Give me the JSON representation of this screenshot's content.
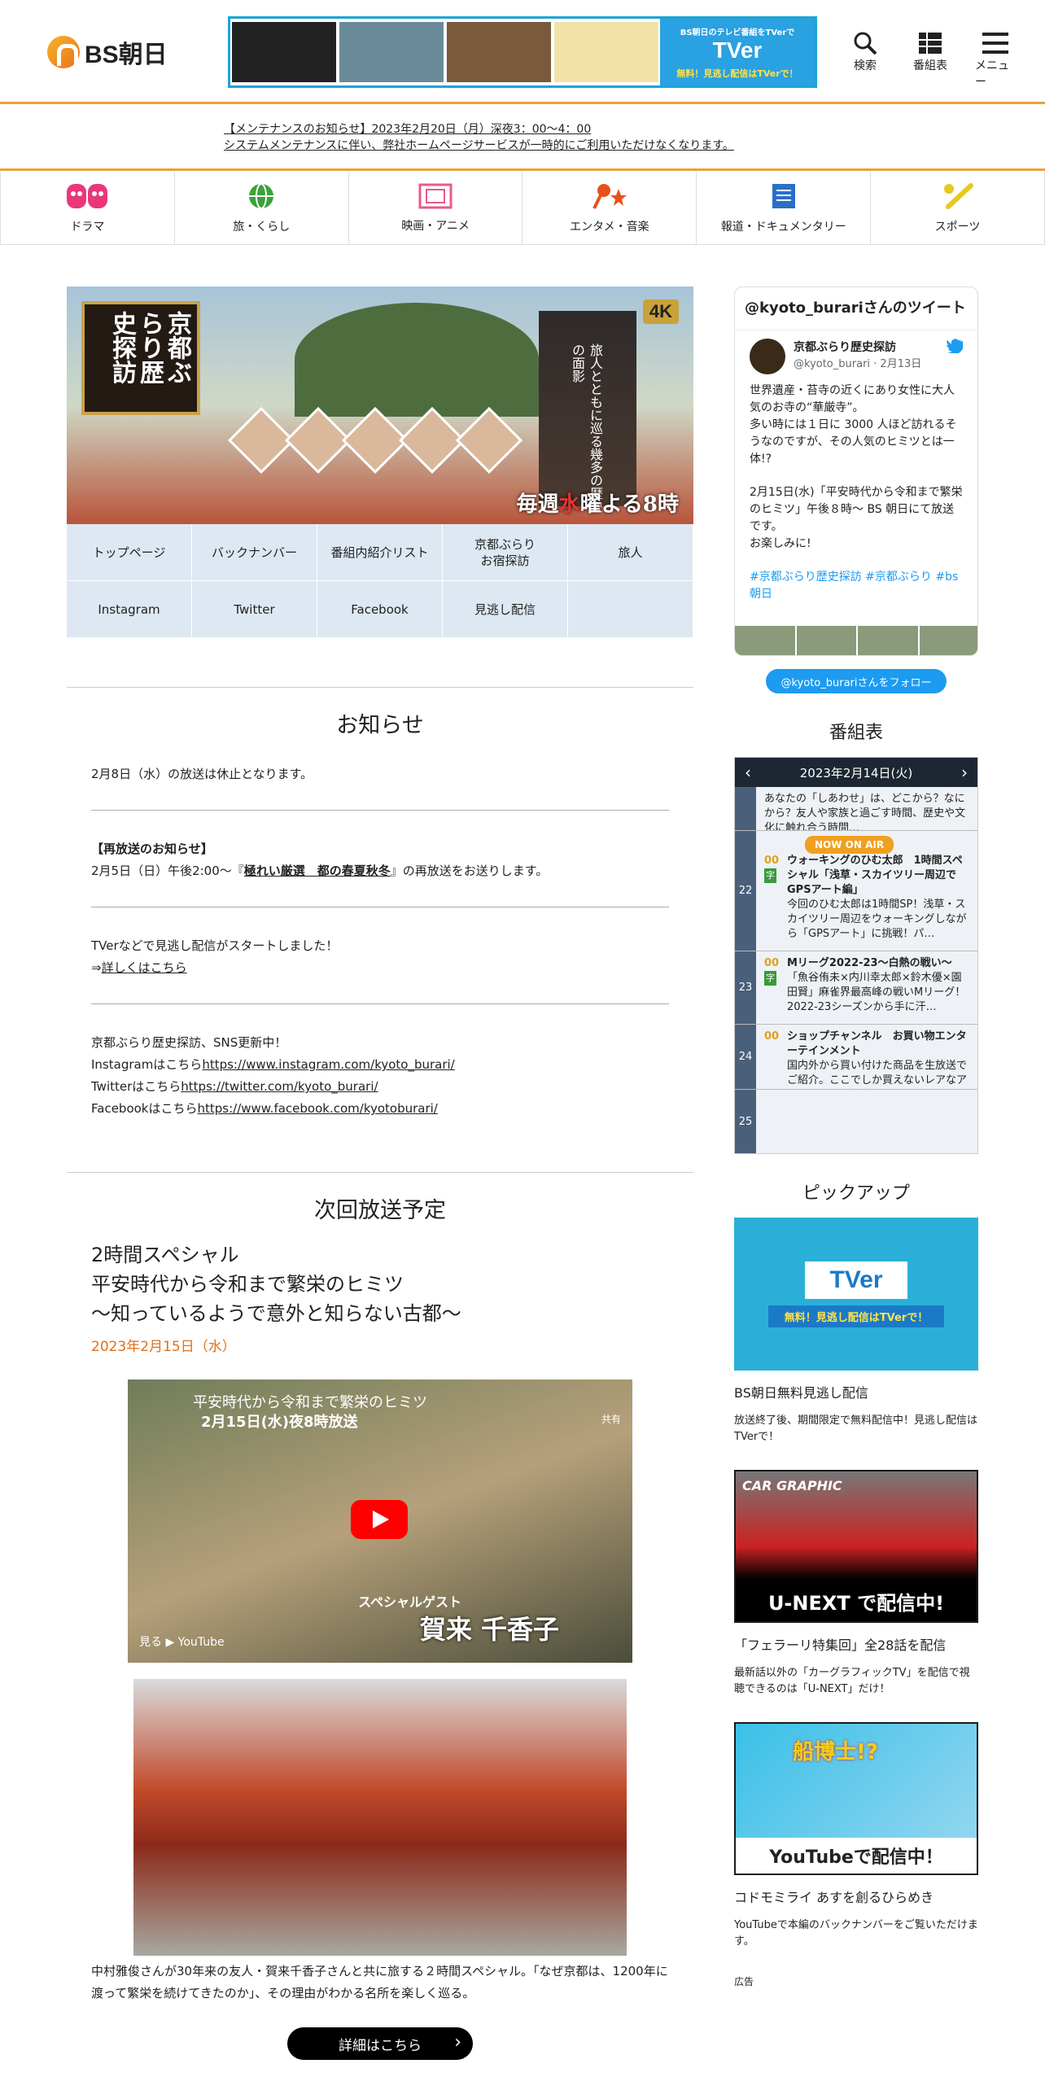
{
  "header": {
    "logo_text": "BS朝日",
    "banner": {
      "tver_logo": "TVer",
      "tver_caption": "無料！見逃し配信はTVerで！",
      "label": "BS朝日のテレビ番組をTVerで"
    },
    "icons": [
      {
        "name": "search-icon",
        "label": "検索"
      },
      {
        "name": "schedule-icon",
        "label": "番組表"
      },
      {
        "name": "menu-icon",
        "label": "メニュー"
      }
    ]
  },
  "notice": {
    "line1": "【メンテナンスのお知らせ】2023年2月20日（月）深夜3：00〜4：00",
    "line2": "システムメンテナンスに伴い、弊社ホームページサービスが一時的にご利用いただけなくなります。"
  },
  "genres": [
    {
      "label": "ドラマ",
      "color": "#e8387a"
    },
    {
      "label": "旅・くらし",
      "color": "#3aa33a"
    },
    {
      "label": "映画・アニメ",
      "color": "#e85a8a"
    },
    {
      "label": "エンタメ・音楽",
      "color": "#e8501a"
    },
    {
      "label": "報道・ドキュメンタリー",
      "color": "#2a6fc8"
    },
    {
      "label": "スポーツ",
      "color": "#e8c81a"
    }
  ],
  "hero": {
    "title": "京都ぶらり歴史探訪",
    "subtitle": "旅人とともに巡る幾多の歴史の面影",
    "badge": "4K",
    "weekly_prefix": "毎週",
    "weekly_day": "水",
    "weekly_suffix": "曜よる8時"
  },
  "program_nav": [
    "トップページ",
    "バックナンバー",
    "番組内紹介リスト",
    "京都ぶらり\nお宿探訪",
    "旅人",
    "Instagram",
    "Twitter",
    "Facebook",
    "見逃し配信",
    ""
  ],
  "news": {
    "heading": "お知らせ",
    "item1": "2月8日（水）の放送は休止となります。",
    "item2_title": "【再放送のお知らせ】",
    "item2_pre": "2月5日（日）午後2:00〜『",
    "item2_link": "極れい厳選　都の春夏秋冬",
    "item2_post": "』の再放送をお送りします。",
    "item3_line1": "TVerなどで見逃し配信がスタートしました！",
    "item3_arrow": "⇒",
    "item3_link": "詳しくはこちら",
    "item4_line1": "京都ぶらり歴史探訪、SNS更新中！",
    "insta_pre": "Instagramはこちら",
    "insta_url": "https://www.instagram.com/kyoto_burari/",
    "twitter_pre": "Twitterはこちら",
    "twitter_url": "https://twitter.com/kyoto_burari/",
    "fb_pre": "Facebookはこちら",
    "fb_url": "https://www.facebook.com/kyotoburari/"
  },
  "next": {
    "heading": "次回放送予定",
    "line1": "2時間スペシャル",
    "line2": "平安時代から令和まで繁栄のヒミツ",
    "line3": "〜知っているようで意外と知らない古都〜",
    "date": "2023年2月15日（水）",
    "video_title": "平安時代から令和まで繁栄のヒミツ",
    "video_sub": "2月15日(水)夜8時放送",
    "video_guest_label": "スペシャルゲスト",
    "video_guest": "賀来 千香子",
    "video_watch": "見る ▶ YouTube",
    "video_share": "共有",
    "desc": "中村雅俊さんが30年来の友人・賀来千香子さんと共に旅する２時間スペシャル。「なぜ京都は、1200年に渡って繁栄を続けてきたのか」、その理由がわかる名所を楽しく巡る。",
    "more": "詳細はこちら"
  },
  "twitter_widget": {
    "heading": "@kyoto_burariさんのツイート",
    "name": "京都ぶらり歴史探訪",
    "handle": "@kyoto_burari · 2月13日",
    "body1": "世界遺産・苔寺の近くにあり女性に大人気のお寺の“華厳寺”。",
    "body2": "多い時には１日に 3000 人ほど訪れるそうなのですが、その人気のヒミツとは一体!?",
    "body3": "2月15日(水)「平安時代から令和まで繁栄のヒミツ」午後８時〜 BS 朝日にて放送です。",
    "body4": "お楽しみに!",
    "tags": "#京都ぶらり歴史探訪 #京都ぶらり #bs朝日",
    "follow": "@kyoto_burariさんをフォロー"
  },
  "schedule": {
    "heading": "番組表",
    "date": "2023年2月14日(火)",
    "prev_row": "あなたの「しあわせ」は、どこから？なにから？友人や家族と過ごす時間、歴史や文化に触れ合う時間…",
    "rows": [
      {
        "hour": "22",
        "min": "00",
        "badge": "字",
        "title": "ウォーキングのひむ太郎　1時間スペシャル「浅草・スカイツリー周辺でGPSアート編」",
        "desc": "今回のひむ太郎は1時間SP！浅草・スカイツリー周辺をウォーキングしながら「GPSアート」に挑戦！パ…",
        "now": "NOW ON AIR"
      },
      {
        "hour": "23",
        "min": "00",
        "badge": "字",
        "title": "Mリーグ2022-23〜白熱の戦い〜",
        "desc": "「魚谷侑未×内川幸太郎×鈴木優×園田賢」麻雀界最高峰の戦いMリーグ！2022-23シーズンから手に汗…",
        "now": ""
      },
      {
        "hour": "24",
        "min": "00",
        "badge": "",
        "title": "ショップチャンネル　お買い物エンターテインメント",
        "desc": "国内外から買い付けた商品を生放送でご紹介。ここでしか買えないレアなアイテムや、人気ブランドのア…",
        "now": ""
      },
      {
        "hour": "25",
        "min": "",
        "badge": "",
        "title": "",
        "desc": "",
        "now": ""
      }
    ]
  },
  "pickup": {
    "heading": "ピックアップ",
    "items": [
      {
        "title": "BS朝日無料見逃し配信",
        "desc": "放送終了後、期間限定で無料配信中！見逃し配信はTVerで！",
        "img_text": "TVer",
        "img_caption": "無料！見逃し配信はTVerで！"
      },
      {
        "title": "「フェラーリ特集回」全28話を配信",
        "desc": "最新話以外の「カーグラフィックTV」を配信で視聴できるのは「U-NEXT」だけ！",
        "img_text": "U-NEXT で配信中!",
        "img_caption": "CAR GRAPHIC"
      },
      {
        "title": "コドモミライ あすを創るひらめき",
        "desc": "YouTubeで本編のバックナンバーをご覧いただけます。",
        "img_text": "YouTubeで配信中！",
        "img_caption": "船博士!?"
      }
    ],
    "ad": "広告"
  }
}
